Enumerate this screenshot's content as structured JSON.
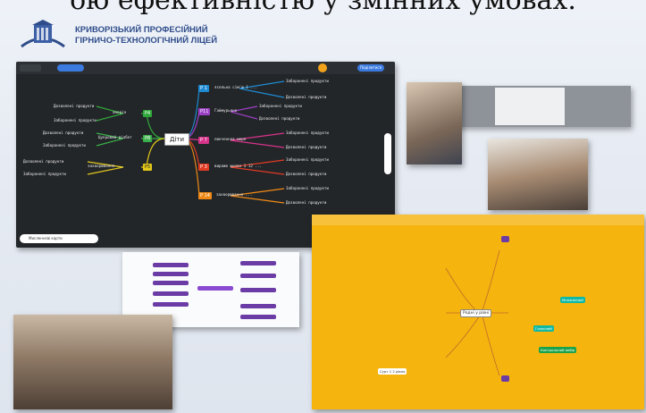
{
  "header": {
    "partial_title": "ою ефективністю у змінних умовах.",
    "institution_line1": "КРИВОРІЗЬКИЙ ПРОФЕСІЙНИЙ",
    "institution_line2": "ГІРНИЧО-ТЕХНОЛОГІЧНИЙ ЛІЦЕЙ"
  },
  "mindmap": {
    "center": "Діти",
    "toolbar_button": "Поділитися",
    "bottom_search": "Мисленнєві карти",
    "branches": [
      {
        "code": "P 1",
        "color": "#1e8ad2",
        "text": "ясельна сім'ю 1 ...",
        "leaves": [
          "Заборонені продукти",
          "Дозволені продукти"
        ]
      },
      {
        "code": "P11",
        "color": "#9b3fc4",
        "text": "Гаймурьяно",
        "leaves": [
          "Заборонені продукти",
          "Дозволені продукти"
        ]
      },
      {
        "code": "P 7",
        "color": "#d6338a",
        "text": "лиеченння меря",
        "leaves": [
          "Заборонені продукти",
          "Дозволені продукти"
        ]
      },
      {
        "code": "P 3",
        "color": "#e03b24",
        "text": "вираже щизве 1 12 ...",
        "leaves": [
          "Заборонені продукти",
          "Дозволені продукти"
        ]
      },
      {
        "code": "P 14",
        "color": "#f08a16",
        "text": "захворювання ...",
        "leaves": [
          "Заборонені продукти",
          "Дозволені продукти"
        ]
      },
      {
        "code": "P4",
        "color": "#2fa83a",
        "text": "анорія",
        "leaves": [
          "Дозволені продукти",
          "Заборонені продукти"
        ]
      },
      {
        "code": "P8",
        "color": "#3ab04a",
        "text": "Цукровий діабет",
        "leaves": [
          "Дозволені продукти",
          "Заборонені продукти"
        ]
      },
      {
        "code": "P5",
        "color": "#e2c81a",
        "text": "захворювання ...",
        "leaves": [
          "Дозволені продукти",
          "Заборонені продукти"
        ]
      }
    ]
  },
  "orange_map": {
    "center": "Родні у рівні",
    "items": [
      "Контрольний вибір",
      "Голосний",
      "Множинний",
      "Сурт 1 2 рівня"
    ]
  }
}
